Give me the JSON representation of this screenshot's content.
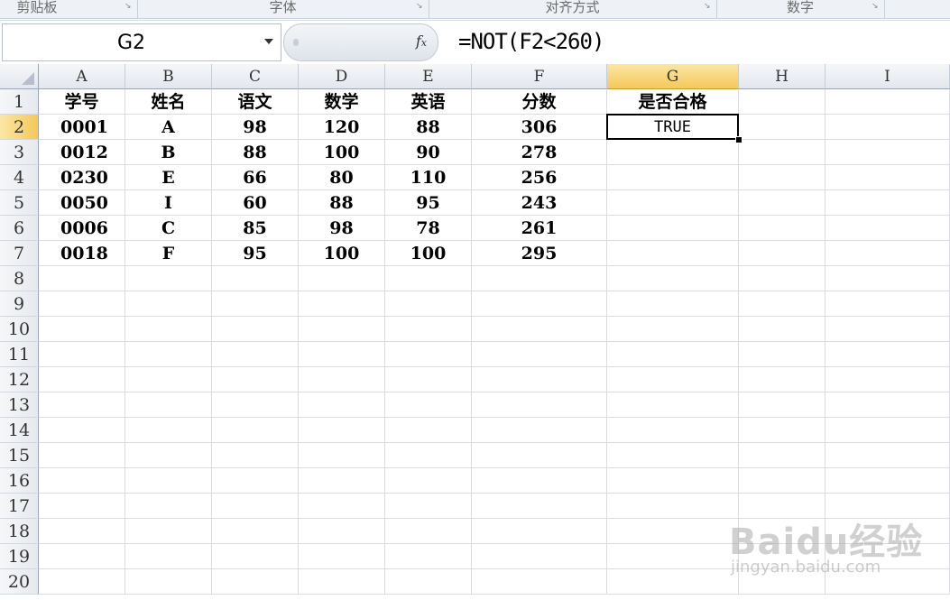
{
  "ribbon": {
    "groups": [
      {
        "label": "剪贴板"
      },
      {
        "label": "字体"
      },
      {
        "label": "对齐方式"
      },
      {
        "label": "数字"
      }
    ]
  },
  "formula_bar": {
    "name_box": "G2",
    "fx_icon": "fx-icon",
    "formula": "=NOT(F2<260)"
  },
  "sheet": {
    "columns": [
      "A",
      "B",
      "C",
      "D",
      "E",
      "F",
      "G",
      "H",
      "I"
    ],
    "selected_column": "G",
    "rows": [
      "1",
      "2",
      "3",
      "4",
      "5",
      "6",
      "7",
      "8",
      "9",
      "10",
      "11",
      "12",
      "13",
      "14",
      "15",
      "16",
      "17",
      "18",
      "19",
      "20"
    ],
    "selected_row": "2",
    "active_cell": "G2",
    "header": [
      "学号",
      "姓名",
      "语文",
      "数学",
      "英语",
      "分数",
      "是否合格"
    ],
    "data": [
      [
        "0001",
        "A",
        "98",
        "120",
        "88",
        "306",
        "TRUE"
      ],
      [
        "0012",
        "B",
        "88",
        "100",
        "90",
        "278",
        ""
      ],
      [
        "0230",
        "E",
        "66",
        "80",
        "110",
        "256",
        ""
      ],
      [
        "0050",
        "I",
        "60",
        "88",
        "95",
        "243",
        ""
      ],
      [
        "0006",
        "C",
        "85",
        "98",
        "78",
        "261",
        ""
      ],
      [
        "0018",
        "F",
        "95",
        "100",
        "100",
        "295",
        ""
      ]
    ]
  },
  "watermark": {
    "main": "Baidu经验",
    "sub": "jingyan.baidu.com"
  },
  "colors": {
    "selected_header": "#f5c85a",
    "grid_line": "#dadcdf"
  }
}
